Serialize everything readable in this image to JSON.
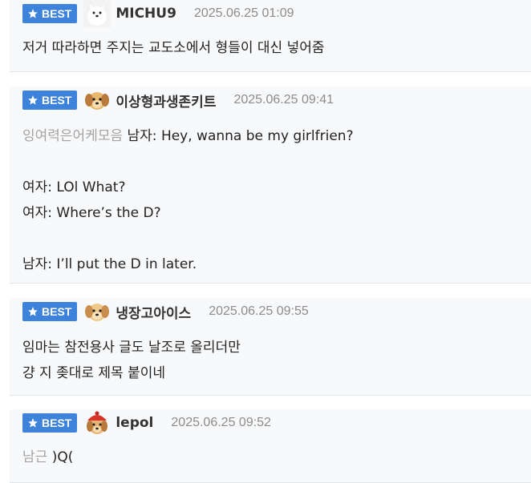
{
  "badge_label": "BEST",
  "comments": [
    {
      "nickname": "MICHU9",
      "date": "2025.06.25 01:09",
      "avatar": "white-dog-avatar",
      "lines": [
        "저거 따라하면 주지는 교도소에서 형들이 대신 넣어줌"
      ]
    },
    {
      "nickname": "이상형과생존키트",
      "date": "2025.06.25 09:41",
      "avatar": "puppy-avatar",
      "prefix": "잉여력은어케모음",
      "lines": [
        "남자: Hey, wanna be my girlfrien?",
        "",
        "여자: LOl What?",
        "여자: Where’s the D?",
        "",
        "남자: I’ll put the D in later."
      ]
    },
    {
      "nickname": "냉장고아이스",
      "date": "2025.06.25 09:55",
      "avatar": "puppy-avatar",
      "lines": [
        "임마는 참전용사 글도 날조로 올리더만",
        "걍 지 좆대로 제목 붙이네"
      ]
    },
    {
      "nickname": "lepol",
      "date": "2025.06.25 09:52",
      "avatar": "red-hat-puppy-avatar",
      "prefix": "남근",
      "lines": [
        ")Q("
      ]
    }
  ],
  "colors": {
    "badge": "#3d83db",
    "card_background": "#f8f9fb",
    "divider": "#e1e4ea",
    "date": "#8c8c8c",
    "prefix_text": "#a3a3a3"
  }
}
